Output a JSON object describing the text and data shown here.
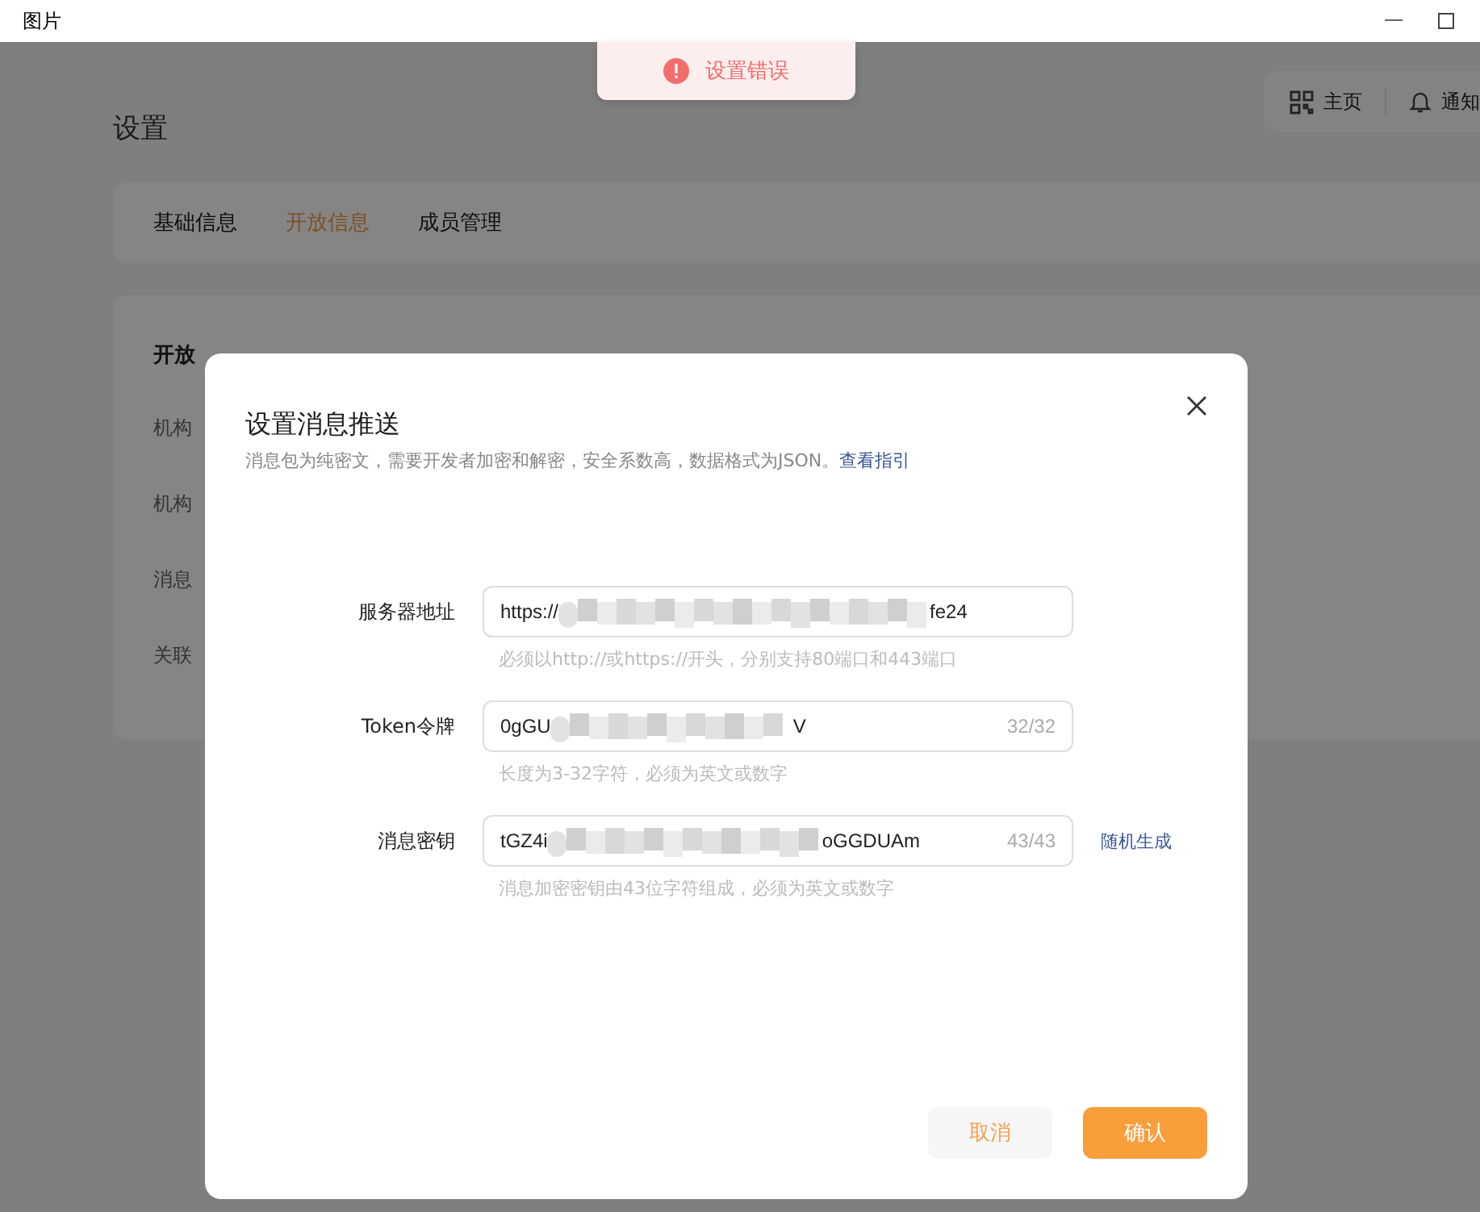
{
  "window": {
    "title": "图片"
  },
  "toast": {
    "message": "设置错误"
  },
  "header_actions": [
    {
      "label": "主页"
    },
    {
      "label": "通知"
    }
  ],
  "page_title": "设置",
  "tabs": [
    {
      "label": "基础信息",
      "selected": false
    },
    {
      "label": "开放信息",
      "selected": true
    },
    {
      "label": "成员管理",
      "selected": false
    }
  ],
  "section": {
    "title": "开放",
    "rows": [
      "机构",
      "机构",
      "消息",
      "关联"
    ]
  },
  "dialog": {
    "title": "设置消息推送",
    "description": "消息包为纯密文，需要开发者加密和解密，安全系数高，数据格式为JSON。",
    "guide_link": "查看指引",
    "fields": [
      {
        "label": "服务器地址",
        "value_start": "https://",
        "value_end": "fe24",
        "hint": "必须以http://或https://开头，分别支持80端口和443端口"
      },
      {
        "label": "Token令牌",
        "value_start": "0gGU",
        "value_end": "V",
        "counter": "32/32",
        "hint": "长度为3-32字符，必须为英文或数字"
      },
      {
        "label": "消息密钥",
        "value_start": "tGZ4i",
        "value_end": "oGGDUAm",
        "counter": "43/43",
        "action": "随机生成",
        "hint": "消息加密密钥由43位字符组成，必须为英文或数字"
      }
    ],
    "buttons": [
      {
        "label": "取消",
        "kind": "secondary"
      },
      {
        "label": "确认",
        "kind": "primary"
      }
    ]
  }
}
